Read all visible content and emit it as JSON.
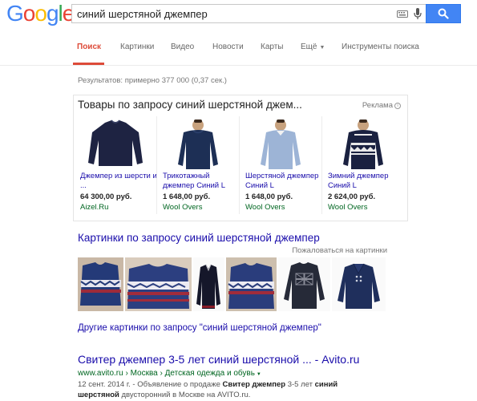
{
  "logo": {
    "text": "Google",
    "letters": [
      "G",
      "o",
      "o",
      "g",
      "l",
      "e"
    ],
    "colors": [
      "#4285f4",
      "#ea4335",
      "#fbbc05",
      "#4285f4",
      "#34a853",
      "#ea4335"
    ]
  },
  "search": {
    "value": "синий шерстяной джемпер"
  },
  "tabs": [
    {
      "label": "Поиск",
      "active": true
    },
    {
      "label": "Картинки"
    },
    {
      "label": "Видео"
    },
    {
      "label": "Новости"
    },
    {
      "label": "Карты"
    },
    {
      "label": "Ещё"
    },
    {
      "label": "Инструменты поиска"
    }
  ],
  "stats": "Результатов: примерно 377 000 (0,37 сек.)",
  "shopping": {
    "title": "Товары по запросу синий шерстяной джем...",
    "ads_label": "Реклама",
    "products": [
      {
        "name": "Джемпер из шерсти и ...",
        "price": "64 300,00 руб.",
        "store": "Aizel.Ru",
        "color": "#1e2342",
        "kind": "sweater"
      },
      {
        "name": "Трикотажный джемпер Синий L",
        "price": "1 648,00 руб.",
        "store": "Wool Overs",
        "color": "#1d2f55",
        "kind": "model"
      },
      {
        "name": "Шерстяной джемпер Синий L",
        "price": "1 648,00 руб.",
        "store": "Wool Overs",
        "color": "#9db4d6",
        "kind": "model"
      },
      {
        "name": "Зимний джемпер Синий L",
        "price": "2 624,00 руб.",
        "store": "Wool Overs",
        "color": "#1a2140",
        "kind": "fairisle"
      }
    ]
  },
  "images": {
    "heading": "Картинки по запросу синий шерстяной джемпер",
    "report": "Пожаловаться на картинки",
    "more_link": "Другие картинки по запросу \"синий шерстяной джемпер\""
  },
  "result": {
    "title": "Свитер джемпер 3-5 лет синий шерстяной ... - Avito.ru",
    "url_domain": "www.avito.ru",
    "url_sep1": "›",
    "url_crumb1": "Москва",
    "url_sep2": "›",
    "url_crumb2": "Детская одежда и обувь",
    "snippet_date": "12 сент. 2014 г. -",
    "snippet_pre": "Объявление о продаже",
    "snippet_bold1": "Свитер джемпер",
    "snippet_mid": "3-5 лет",
    "snippet_bold2": "синий шерстяной",
    "snippet_post": "двусторонний в Москве на AVITO.ru."
  }
}
